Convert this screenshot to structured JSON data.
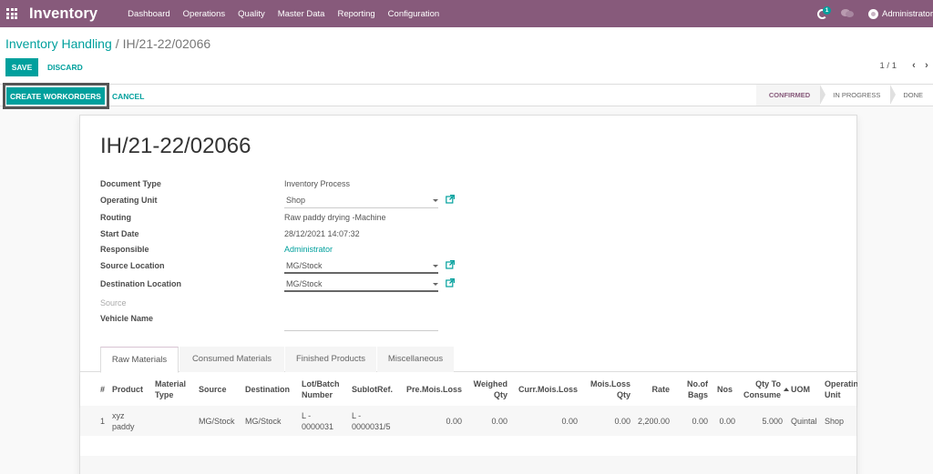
{
  "navbar": {
    "brand": "Inventory",
    "menu": [
      "Dashboard",
      "Operations",
      "Quality",
      "Master Data",
      "Reporting",
      "Configuration"
    ],
    "activity_badge": "1",
    "user": "Administrator"
  },
  "breadcrumb": {
    "parent": "Inventory Handling",
    "separator": "/",
    "current": "IH/21-22/02066"
  },
  "toolbar": {
    "save_label": "SAVE",
    "discard_label": "DISCARD",
    "pager": "1 / 1",
    "prev": "‹",
    "next": "›"
  },
  "statusbar": {
    "create_workorders_label": "CREATE WORKORDERS",
    "cancel_label": "CANCEL",
    "stages": [
      "CONFIRMED",
      "IN PROGRESS",
      "DONE"
    ],
    "active_stage": "CONFIRMED"
  },
  "record": {
    "title": "IH/21-22/02066",
    "fields": {
      "document_type": {
        "label": "Document Type",
        "value": "Inventory Process"
      },
      "operating_unit": {
        "label": "Operating Unit",
        "value": "Shop"
      },
      "routing": {
        "label": "Routing",
        "value": "Raw paddy drying -Machine"
      },
      "start_date": {
        "label": "Start Date",
        "value": "28/12/2021 14:07:32"
      },
      "responsible": {
        "label": "Responsible",
        "value": "Administrator"
      },
      "source_location": {
        "label": "Source Location",
        "value": "MG/Stock"
      },
      "destination_location": {
        "label": "Destination Location",
        "value": "MG/Stock"
      },
      "source": {
        "label": "Source",
        "value": ""
      },
      "vehicle_name": {
        "label": "Vehicle Name",
        "value": ""
      }
    }
  },
  "tabs": [
    "Raw Materials",
    "Consumed Materials",
    "Finished Products",
    "Miscellaneous"
  ],
  "active_tab": "Raw Materials",
  "table": {
    "columns": [
      "#",
      "Product",
      "Material Type",
      "Source",
      "Destination",
      "Lot/Batch Number",
      "SublotRef.",
      "Pre.Mois.Loss",
      "Weighed Qty",
      "Curr.Mois.Loss",
      "Mois.Loss Qty",
      "Rate",
      "No.of Bags",
      "Nos",
      "Qty To Consume",
      "UOM",
      "Operating Unit"
    ],
    "sorted_column": "Qty To Consume",
    "rows": [
      [
        "1",
        "xyz paddy",
        "",
        "MG/Stock",
        "MG/Stock",
        "L - 0000031",
        "L - 0000031/5",
        "0.00",
        "0.00",
        "0.00",
        "0.00",
        "2,200.00",
        "0.00",
        "0.00",
        "5.000",
        "Quintal",
        "Shop"
      ]
    ]
  }
}
